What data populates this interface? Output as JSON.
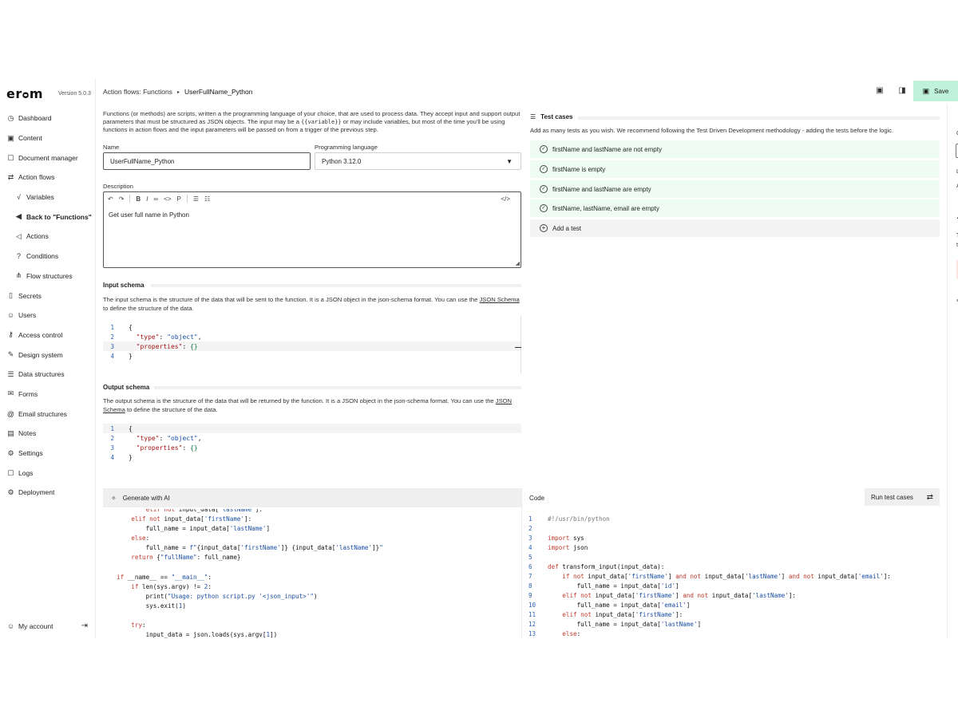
{
  "brand": {
    "logo": "er o m",
    "version": "Version 5.0.3"
  },
  "sidebar": {
    "items": [
      {
        "label": "Dashboard",
        "icon": "dashboard-icon",
        "glyph": "◷"
      },
      {
        "label": "Content",
        "icon": "content-icon",
        "glyph": "▣"
      },
      {
        "label": "Document manager",
        "icon": "document-icon",
        "glyph": "▢"
      },
      {
        "label": "Action flows",
        "icon": "action-flows-icon",
        "glyph": "⇄"
      },
      {
        "label": "Variables",
        "icon": "variables-icon",
        "glyph": "√"
      },
      {
        "label": "Back to \"Functions\"",
        "icon": "back-icon",
        "glyph": "◀"
      },
      {
        "label": "Actions",
        "icon": "actions-icon",
        "glyph": "◁"
      },
      {
        "label": "Conditions",
        "icon": "conditions-icon",
        "glyph": "?"
      },
      {
        "label": "Flow structures",
        "icon": "flow-structures-icon",
        "glyph": "⋔"
      },
      {
        "label": "Secrets",
        "icon": "secrets-icon",
        "glyph": "▯"
      },
      {
        "label": "Users",
        "icon": "users-icon",
        "glyph": "☺"
      },
      {
        "label": "Access control",
        "icon": "access-control-icon",
        "glyph": "⚷"
      },
      {
        "label": "Design system",
        "icon": "design-system-icon",
        "glyph": "✎"
      },
      {
        "label": "Data structures",
        "icon": "data-structures-icon",
        "glyph": "☰"
      },
      {
        "label": "Forms",
        "icon": "forms-icon",
        "glyph": "✉"
      },
      {
        "label": "Email structures",
        "icon": "email-structures-icon",
        "glyph": "@"
      },
      {
        "label": "Notes",
        "icon": "notes-icon",
        "glyph": "▤"
      },
      {
        "label": "Settings",
        "icon": "settings-icon",
        "glyph": "⚙"
      },
      {
        "label": "Logs",
        "icon": "logs-icon",
        "glyph": "▢"
      },
      {
        "label": "Deployment",
        "icon": "deployment-icon",
        "glyph": "⚙"
      }
    ],
    "account": "My account"
  },
  "topbar": {
    "crumb_parent": "Action flows: Functions",
    "crumb_current": "UserFullName_Python",
    "save": "Save"
  },
  "form": {
    "intro_1": "Functions (or methods) are scripts, written a the programming language of your choice, that are used to process data. They accept input and support output parameters that must be structured as JSON objects. The input may be a ",
    "intro_var": "{{variable}}",
    "intro_2": " or may include variables, but most of the time you'll be using functions in action flows and the input parameters will be passed on from a trigger of the previous step.",
    "name_label": "Name",
    "name_value": "UserFullName_Python",
    "language_label": "Programming language",
    "language_value": "Python 3.12.0",
    "description_label": "Description",
    "description_value": "Get user full name in Python"
  },
  "input_schema": {
    "title": "Input schema",
    "desc_1": "The input schema is the structure of the data that will be sent to the function. It is a JSON object in the json-schema format. You can use the ",
    "link": "JSON Schema",
    "desc_2": " to define the structure of the data."
  },
  "output_schema": {
    "title": "Output schema",
    "desc_1": "The output schema is the structure of the data that will be returned by the function. It is a JSON object in the json-schema format. You can use the ",
    "link": "JSON Schema",
    "desc_2": " to define the structure of the data."
  },
  "tests": {
    "title": "Test cases",
    "desc": "Add as many tests as you wish. We recommend following the Test Driven Development methodology - adding the tests before the logic.",
    "items": [
      "firstName and lastName are not empty",
      "firstName is empty",
      "firstName and lastName are empty",
      "firstName, lastName, email are empty"
    ],
    "add": "Add a test"
  },
  "ai": {
    "title": "Generate with AI"
  },
  "code": {
    "title": "Code",
    "run": "Run test cases"
  }
}
